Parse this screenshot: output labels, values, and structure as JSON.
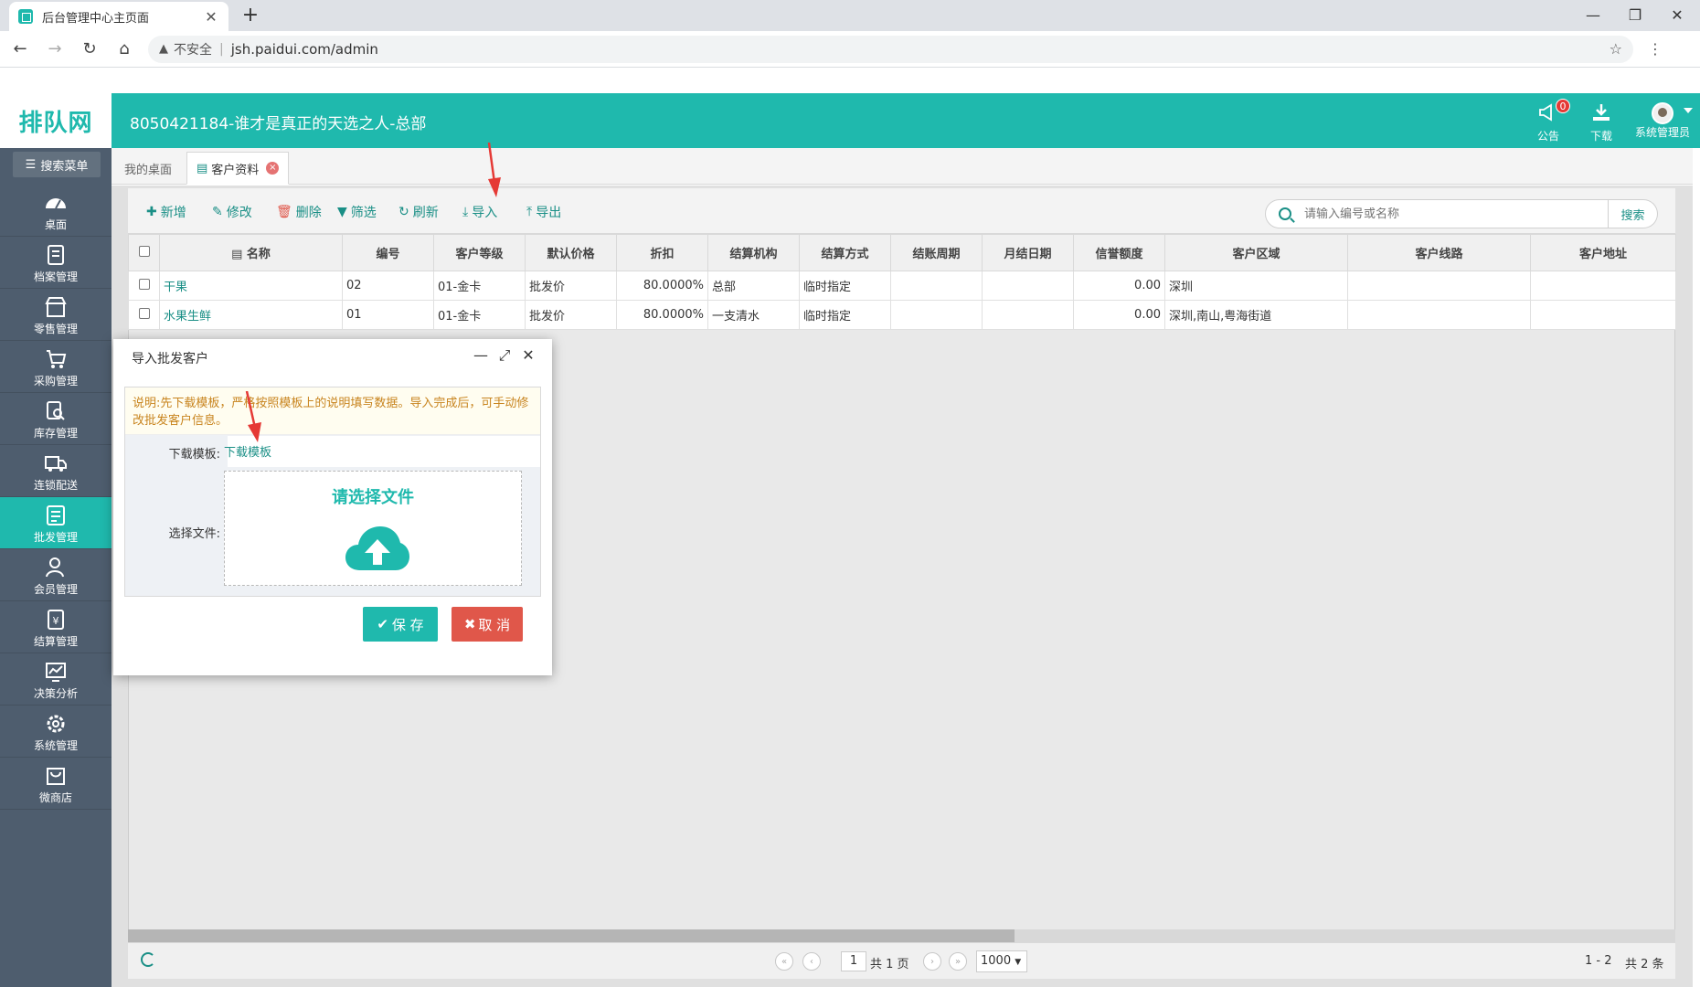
{
  "browser": {
    "tab_title": "后台管理中心主页面",
    "security_label": "不安全",
    "url": "jsh.paidui.com/admin"
  },
  "header": {
    "logo": "排队网",
    "company": "8050421184-谁才是真正的天选之人-总部",
    "notice_label": "公告",
    "notice_count": "0",
    "download_label": "下载",
    "user_label": "系统管理员"
  },
  "sidebar": {
    "search_label": "搜索菜单",
    "items": [
      {
        "label": "桌面",
        "icon": "dashboard-icon"
      },
      {
        "label": "档案管理",
        "icon": "archive-icon"
      },
      {
        "label": "零售管理",
        "icon": "store-icon"
      },
      {
        "label": "采购管理",
        "icon": "purchase-icon"
      },
      {
        "label": "库存管理",
        "icon": "inventory-icon"
      },
      {
        "label": "连锁配送",
        "icon": "delivery-icon"
      },
      {
        "label": "批发管理",
        "icon": "wholesale-icon"
      },
      {
        "label": "会员管理",
        "icon": "member-icon"
      },
      {
        "label": "结算管理",
        "icon": "settlement-icon"
      },
      {
        "label": "决策分析",
        "icon": "analysis-icon"
      },
      {
        "label": "系统管理",
        "icon": "settings-icon"
      },
      {
        "label": "微商店",
        "icon": "shop-icon"
      }
    ],
    "active_index": 6
  },
  "tabs": [
    {
      "label": "我的桌面"
    },
    {
      "label": "客户资料"
    }
  ],
  "toolbar": {
    "add": "新增",
    "edit": "修改",
    "delete": "删除",
    "filter": "筛选",
    "refresh": "刷新",
    "import": "导入",
    "export": "导出",
    "search_placeholder": "请输入编号或名称",
    "search_button": "搜索"
  },
  "table": {
    "columns": [
      "名称",
      "编号",
      "客户等级",
      "默认价格",
      "折扣",
      "结算机构",
      "结算方式",
      "结账周期",
      "月结日期",
      "信誉额度",
      "客户区域",
      "客户线路",
      "客户地址"
    ],
    "rows": [
      [
        "干果",
        "02",
        "01-金卡",
        "批发价",
        "80.0000%",
        "总部",
        "临时指定",
        "",
        "",
        "0.00",
        "深圳",
        "",
        ""
      ],
      [
        "水果生鲜",
        "01",
        "01-金卡",
        "批发价",
        "80.0000%",
        "一支清水",
        "临时指定",
        "",
        "",
        "0.00",
        "深圳,南山,粤海街道",
        "",
        ""
      ]
    ]
  },
  "pager": {
    "page": "1",
    "total_pages": "共 1 页",
    "page_size": "1000",
    "range": "1 - 2",
    "total": "共 2 条"
  },
  "dialog": {
    "title": "导入批发客户",
    "notice": "说明:先下载模板，严格按照模板上的说明填写数据。导入完成后，可手动修改批发客户信息。",
    "template_label": "下载模板:",
    "template_link": "下载模板",
    "file_label": "选择文件:",
    "dropzone_title": "请选择文件",
    "save": "保 存",
    "cancel": "取 消"
  },
  "colors": {
    "brand": "#1fb9ad",
    "sidebar": "#4e5d6e",
    "danger": "#e0574a",
    "annotation_arrow": "#e53935"
  }
}
